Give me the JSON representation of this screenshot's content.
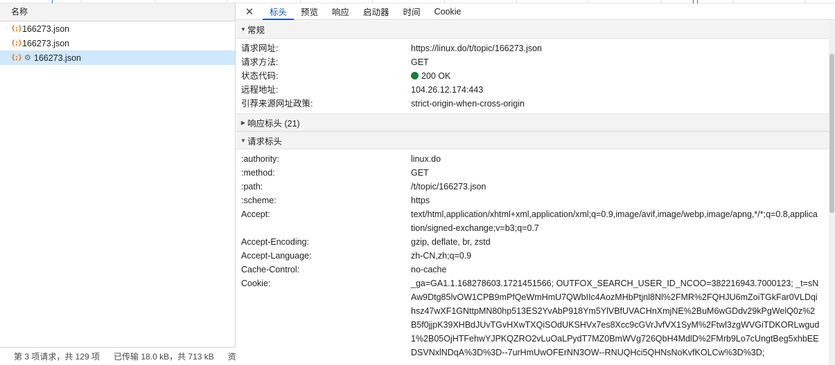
{
  "left_panel": {
    "header": "名称",
    "files": [
      {
        "name": "166273.json"
      },
      {
        "name": "166273.json"
      },
      {
        "name": "166273.json"
      }
    ],
    "status": {
      "requests": "第 3 项请求，共 129 项",
      "transferred": "已传输 18.0 kB，共 713 kB",
      "more": "资"
    }
  },
  "tabs": {
    "close": "✕",
    "items": [
      "标头",
      "预览",
      "响应",
      "启动器",
      "时间",
      "Cookie"
    ],
    "active": "标头"
  },
  "general": {
    "title": "常规",
    "rows": [
      {
        "key": "请求网址:",
        "value": "https://linux.do/t/topic/166273.json"
      },
      {
        "key": "请求方法:",
        "value": "GET"
      },
      {
        "key": "状态代码:",
        "value": "200 OK"
      },
      {
        "key": "远程地址:",
        "value": "104.26.12.174:443"
      },
      {
        "key": "引荐来源网址政策:",
        "value": "strict-origin-when-cross-origin"
      }
    ]
  },
  "response_headers": {
    "title": "响应标头 (21)"
  },
  "request_headers": {
    "title": "请求标头",
    "rows": [
      {
        "key": ":authority:",
        "value": "linux.do"
      },
      {
        "key": ":method:",
        "value": "GET"
      },
      {
        "key": ":path:",
        "value": "/t/topic/166273.json"
      },
      {
        "key": ":scheme:",
        "value": "https"
      },
      {
        "key": "Accept:",
        "value": "text/html,application/xhtml+xml,application/xml;q=0.9,image/avif,image/webp,image/apng,*/*;q=0.8,application/signed-exchange;v=b3;q=0.7"
      },
      {
        "key": "Accept-Encoding:",
        "value": "gzip, deflate, br, zstd"
      },
      {
        "key": "Accept-Language:",
        "value": "zh-CN,zh;q=0.9"
      },
      {
        "key": "Cache-Control:",
        "value": "no-cache"
      },
      {
        "key": "Cookie:",
        "value": "_ga=GA1.1.168278603.1721451566; OUTFOX_SEARCH_USER_ID_NCOO=382216943.7000123; _t=sNAw9Dtg85lvOW1CPB9mPfQeWmHmU7QWbIIc4AozMHbPtjnl8Nl%2FMR%2FQHJU6mZoiTGkFar0VLDqihsz47wXF1GNttpMN80hp513ES2YvAbP918Ym5YlVBfUVACHnXmjNE%2BuM6wGDdv29kPgWelQ0z%2B5f0jjpK39XHBdJUvTGvHXwTXQiSOdUKSHVx7es8Xcc9cGVrJvfVX1SyM%2Ftwl3zgWVGiTDKORLwgud1%2B05OjHTFehwYJPKQZRO2vLuOaLPydT7MZ0BmWVg726QbH4MdlD%2FMrb9Lo7cUngtBeg5xhbEEDSVNxlNDqA%3D%3D--7urHmUwOFErNN3OW--RNUQHci5QHNsNoKvfKOLCw%3D%3D;"
      }
    ]
  },
  "colors": {
    "accent": "#0b57d0",
    "status_ok": "#188038",
    "json_icon": "#e8710a",
    "selected_row": "#cfe8fc"
  }
}
